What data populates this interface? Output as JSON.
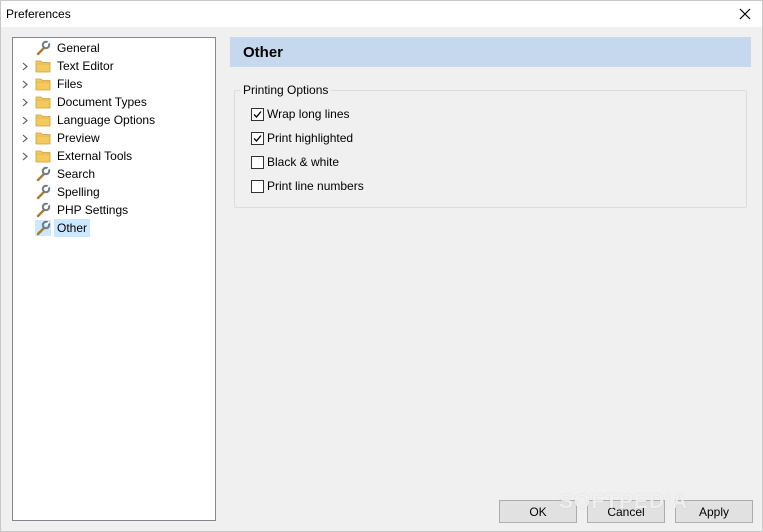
{
  "window": {
    "title": "Preferences"
  },
  "tree": {
    "items": [
      {
        "label": "General",
        "icon": "wrench-icon",
        "expandable": false,
        "selected": false
      },
      {
        "label": "Text Editor",
        "icon": "folder-icon",
        "expandable": true,
        "selected": false
      },
      {
        "label": "Files",
        "icon": "folder-icon",
        "expandable": true,
        "selected": false
      },
      {
        "label": "Document Types",
        "icon": "folder-icon",
        "expandable": true,
        "selected": false
      },
      {
        "label": "Language Options",
        "icon": "folder-icon",
        "expandable": true,
        "selected": false
      },
      {
        "label": "Preview",
        "icon": "folder-icon",
        "expandable": true,
        "selected": false
      },
      {
        "label": "External Tools",
        "icon": "folder-icon",
        "expandable": true,
        "selected": false
      },
      {
        "label": "Search",
        "icon": "wrench-icon",
        "expandable": false,
        "selected": false
      },
      {
        "label": "Spelling",
        "icon": "wrench-icon",
        "expandable": false,
        "selected": false
      },
      {
        "label": "PHP Settings",
        "icon": "wrench-icon",
        "expandable": false,
        "selected": false
      },
      {
        "label": "Other",
        "icon": "wrench-icon",
        "expandable": false,
        "selected": true
      }
    ]
  },
  "panel": {
    "title": "Other",
    "group": {
      "legend": "Printing Options",
      "options": [
        {
          "label": "Wrap long lines",
          "checked": true
        },
        {
          "label": "Print highlighted",
          "checked": true
        },
        {
          "label": "Black & white",
          "checked": false
        },
        {
          "label": "Print line numbers",
          "checked": false
        }
      ]
    }
  },
  "buttons": {
    "ok": "OK",
    "cancel": "Cancel",
    "apply": "Apply"
  },
  "watermark": "SOFTPEDIA",
  "colors": {
    "header_band": "#c5d8ee",
    "selection": "#cce8ff",
    "folder": "#f4c95d"
  }
}
